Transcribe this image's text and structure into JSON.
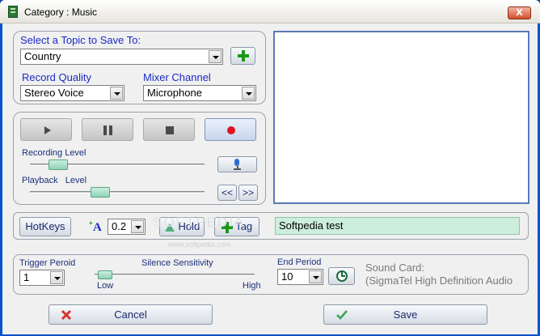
{
  "window": {
    "title": "Category : Music",
    "close_glyph": "X"
  },
  "topic": {
    "label": "Select a Topic to Save To:",
    "selected": "Country",
    "add_icon": "plus-icon"
  },
  "record_quality": {
    "label": "Record Quality",
    "selected": "Stereo Voice"
  },
  "mixer_channel": {
    "label": "Mixer Channel",
    "selected": "Microphone"
  },
  "transport": {
    "play_icon": "play-icon",
    "pause_icon": "pause-icon",
    "stop_icon": "stop-icon",
    "record_icon": "record-icon"
  },
  "recording_level": {
    "label": "Recording Level",
    "level": 0.12
  },
  "playback_level": {
    "label": "Playback   Level",
    "level": 0.39
  },
  "seek": {
    "back_label": "<<",
    "forward_label": ">>"
  },
  "toolbar": {
    "hotkeys_label": "HotKeys",
    "font_size_value": "0.2",
    "hold_label": "Hold",
    "tag_label": "Tag",
    "note_text": "Softpedia test"
  },
  "watermark": {
    "main": "SOFTPEDIA",
    "sub": "www.softpedia.com"
  },
  "trigger": {
    "label": "Trigger Peroid",
    "selected": "1"
  },
  "silence": {
    "label": "Silence Sensitivity",
    "low_label": "Low",
    "high_label": "High",
    "level": 0.02
  },
  "end_period": {
    "label": "End Period",
    "selected": "10"
  },
  "sound_card": {
    "line1": "Sound Card:",
    "line2": "(SigmaTel High Definition Audio"
  },
  "footer": {
    "cancel_label": "Cancel",
    "save_label": "Save"
  },
  "colors": {
    "accent_blue": "#1c2bc4",
    "record_red": "#e0141e",
    "level_green": "#8fd2b4",
    "titlebar_close": "#d14f2c"
  }
}
